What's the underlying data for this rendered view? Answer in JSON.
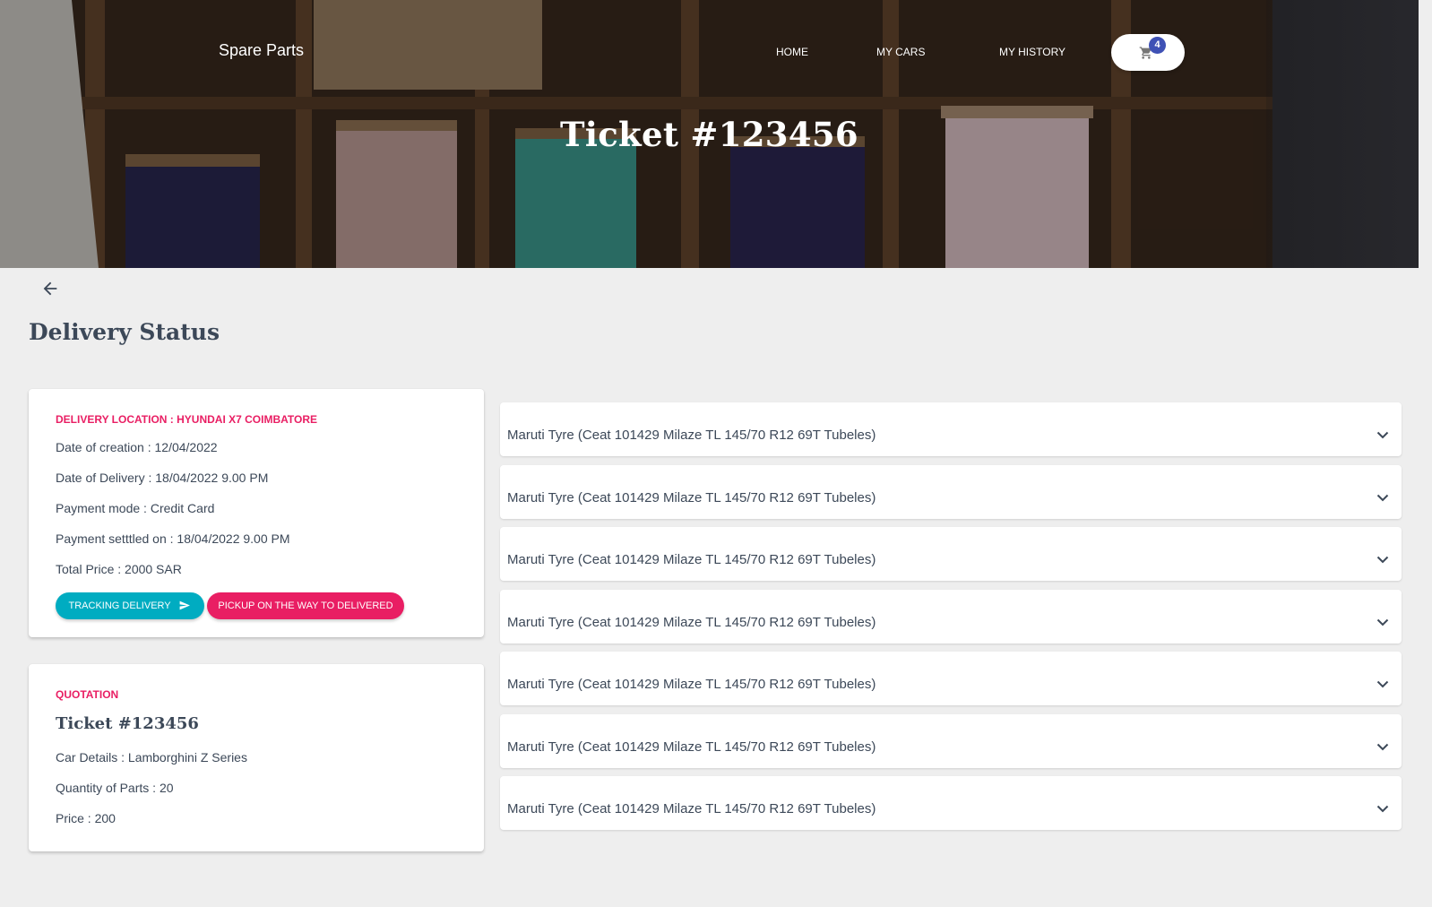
{
  "header": {
    "brand": "Spare Parts",
    "nav": [
      "HOME",
      "MY CARS",
      "MY HISTORY"
    ],
    "cart_count": "4",
    "title": "Ticket #123456"
  },
  "page": {
    "section_title": "Delivery Status"
  },
  "delivery_card": {
    "label": "DELIVERY LOCATION : HYUNDAI X7 COIMBATORE",
    "lines": [
      "Date of creation : 12/04/2022",
      "Date of Delivery : 18/04/2022 9.00 PM",
      "Payment mode : Credit Card",
      "Payment setttled on : 18/04/2022 9.00 PM",
      "Total Price : 2000 SAR"
    ],
    "track_button": "TRACKING DELIVERY",
    "pickup_button": "PICKUP ON THE WAY TO DELIVERED"
  },
  "quotation_card": {
    "label": "QUOTATION",
    "heading": "Ticket #123456",
    "lines": [
      "Car Details : Lamborghini Z Series",
      "Quantity of Parts : 20",
      "Price : 200"
    ]
  },
  "items": [
    "Maruti Tyre (Ceat 101429 Milaze TL 145/70 R12 69T Tubeles)",
    "Maruti Tyre (Ceat 101429 Milaze TL 145/70 R12 69T Tubeles)",
    "Maruti Tyre (Ceat 101429 Milaze TL 145/70 R12 69T Tubeles)",
    "Maruti Tyre (Ceat 101429 Milaze TL 145/70 R12 69T Tubeles)",
    "Maruti Tyre (Ceat 101429 Milaze TL 145/70 R12 69T Tubeles)",
    "Maruti Tyre (Ceat 101429 Milaze TL 145/70 R12 69T Tubeles)",
    "Maruti Tyre (Ceat 101429 Milaze TL 145/70 R12 69T Tubeles)"
  ],
  "colors": {
    "accent_pink": "#e91e63",
    "accent_cyan": "#00acc1",
    "badge_blue": "#3f51b5",
    "background": "#eeeeee"
  },
  "icons": [
    "shopping-cart-icon",
    "back-arrow-icon",
    "send-icon",
    "chevron-down-icon"
  ]
}
